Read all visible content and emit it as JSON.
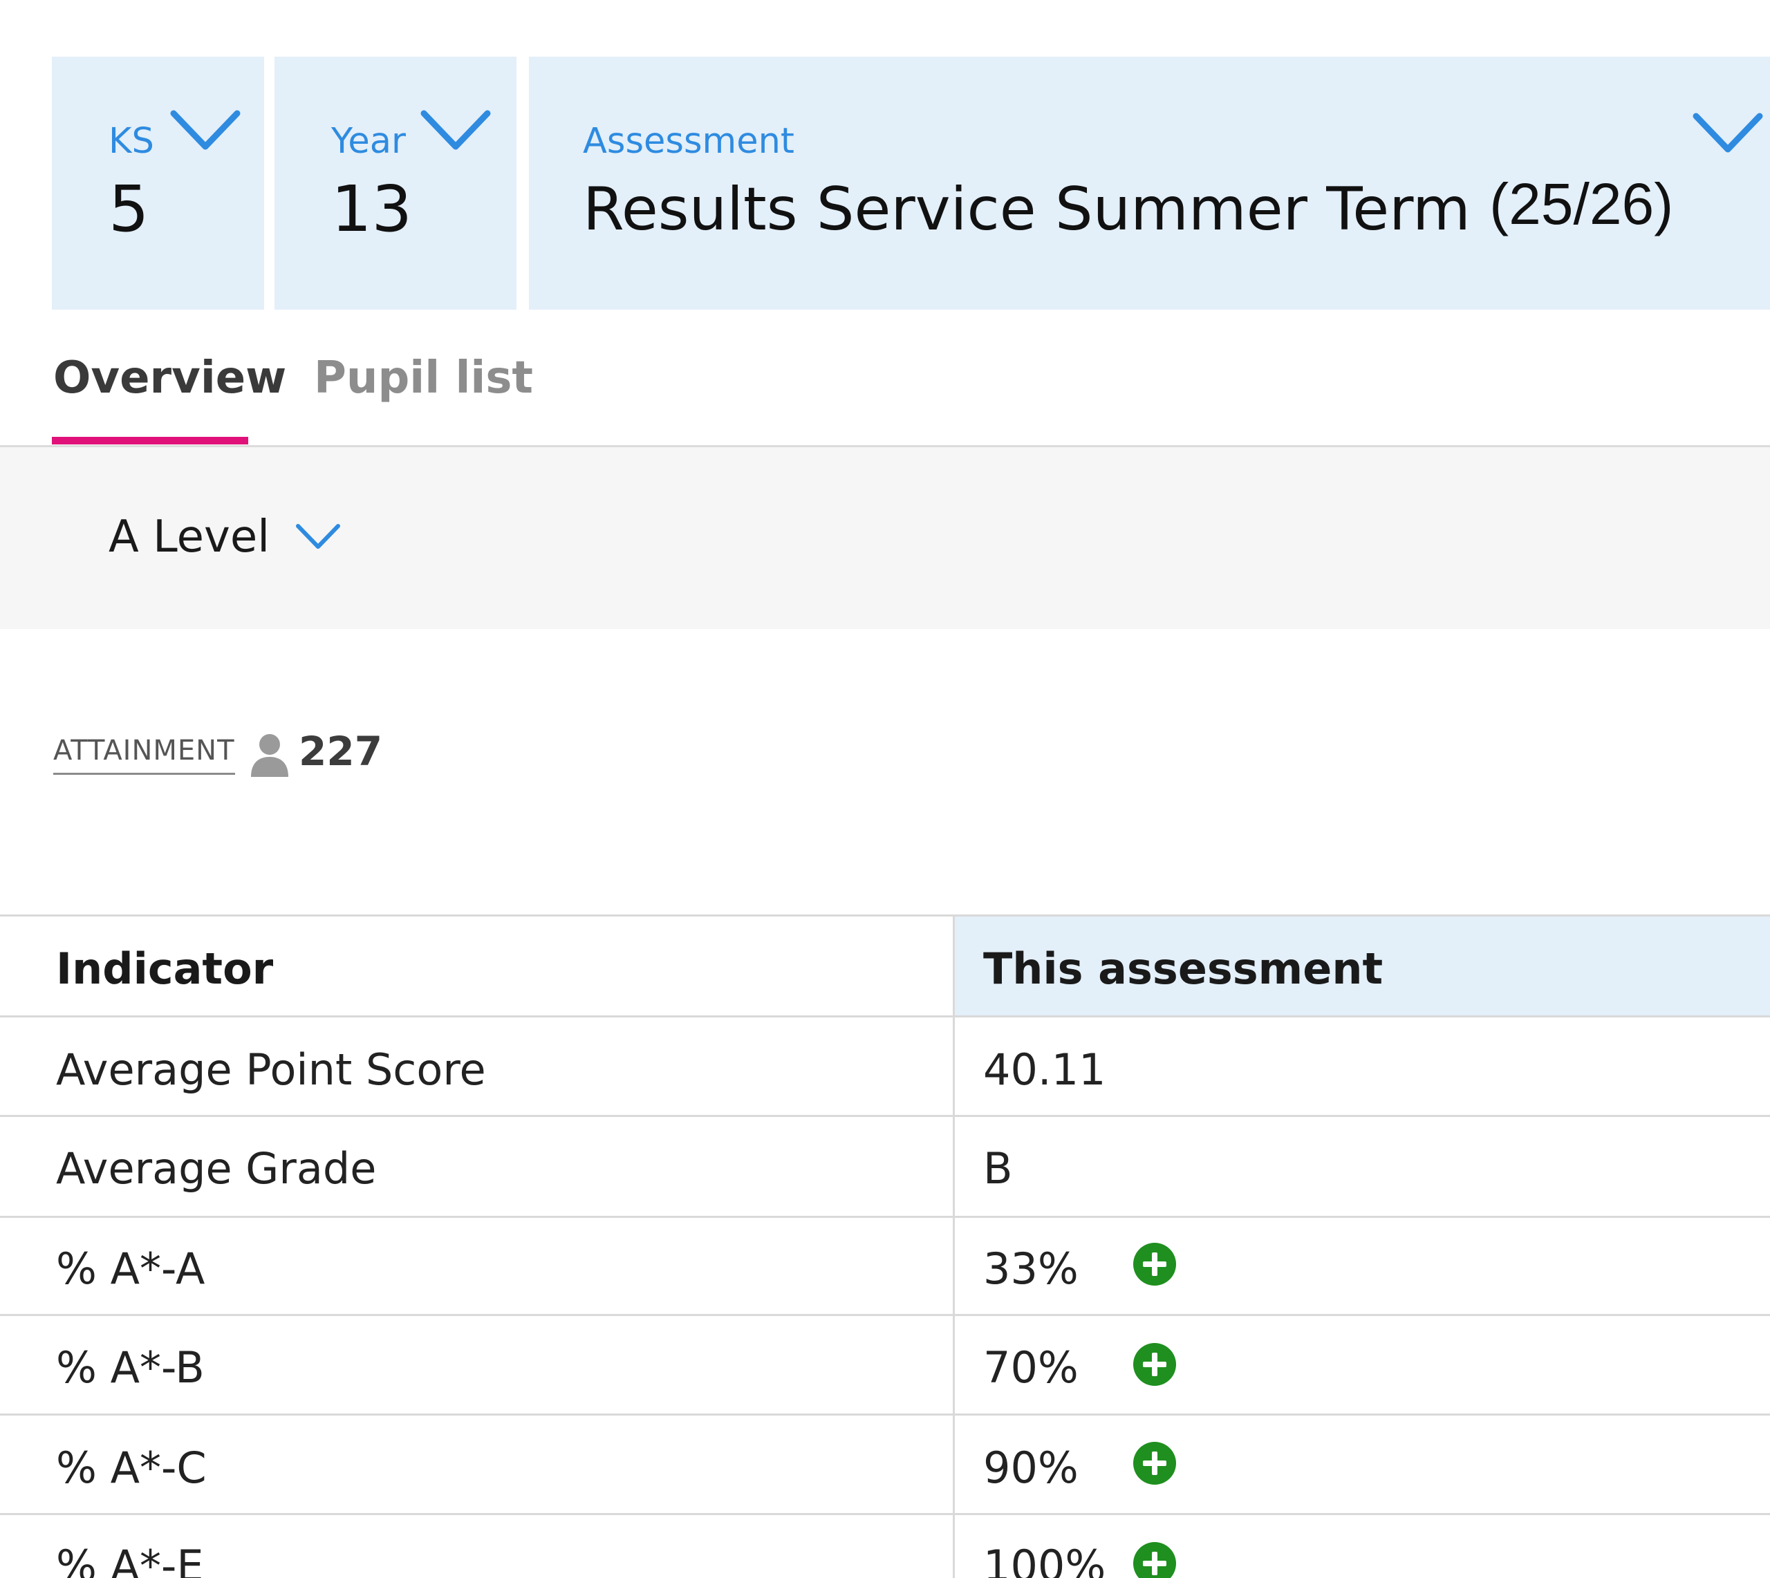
{
  "selectors": {
    "ks": {
      "label": "KS",
      "value": "5"
    },
    "year": {
      "label": "Year",
      "value": "13"
    },
    "assessment": {
      "label": "Assessment",
      "value": "Results Service Summer Term",
      "term": "(25/26)"
    }
  },
  "tabs": [
    {
      "label": "Overview",
      "active": true
    },
    {
      "label": "Pupil list",
      "active": false
    }
  ],
  "filter": {
    "value": "A Level"
  },
  "attainment": {
    "label": "ATTAINMENT",
    "icon": "person-icon",
    "count": "227"
  },
  "table": {
    "headers": [
      "Indicator",
      "This assessment"
    ],
    "rows": [
      {
        "indicator": "Average Point Score",
        "value": "40.11",
        "icon": null
      },
      {
        "indicator": "Average Grade",
        "value": "B",
        "icon": null
      },
      {
        "indicator": "% A*-A",
        "value": "33%",
        "icon": "plus-circle-icon"
      },
      {
        "indicator": "% A*-B",
        "value": "70%",
        "icon": "plus-circle-icon"
      },
      {
        "indicator": "% A*-C",
        "value": "90%",
        "icon": "plus-circle-icon"
      },
      {
        "indicator": "% A*-E",
        "value": "100%",
        "icon": "plus-circle-icon"
      }
    ]
  },
  "colors": {
    "accent_blue": "#2e8be0",
    "selector_bg": "#e3eff9",
    "tab_underline": "#e0127a",
    "positive_green": "#1f8f1f"
  }
}
